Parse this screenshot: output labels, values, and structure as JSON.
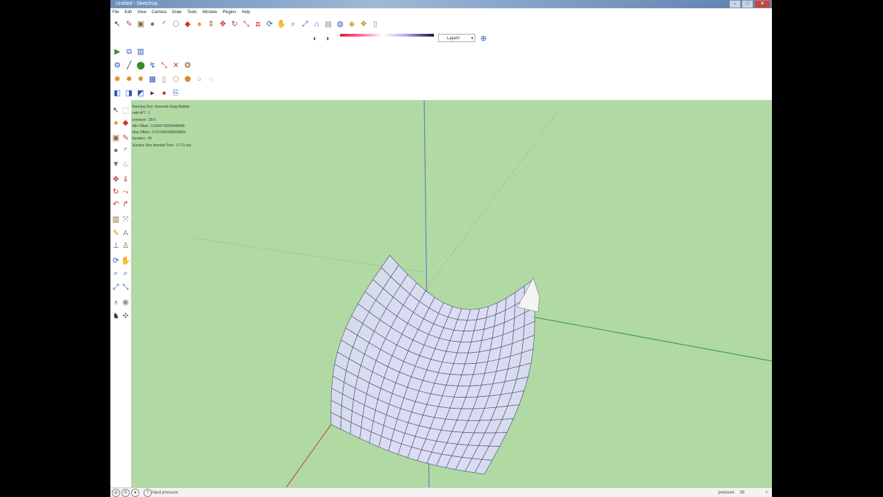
{
  "window": {
    "title": "Untitled - SketchUp"
  },
  "menu": [
    "File",
    "Edit",
    "View",
    "Camera",
    "Draw",
    "Tools",
    "Window",
    "Plugins",
    "Help"
  ],
  "layer": {
    "name": "Layer0"
  },
  "overlay": {
    "lines": [
      "Running Tool: Generate Soap Bubble",
      "ratio A/T : 1",
      "pressure : 39.0",
      "Min Offset : 0.0265715035649089",
      "Max Offset : 0.0174352686595864",
      "Iteration : 43",
      "Surface Size Needed Time : 0.772 sec."
    ]
  },
  "status": {
    "hint": "Input pressure",
    "value_label": "pressure",
    "value": "39",
    "close": "×"
  },
  "icons": {
    "row1": [
      "select-icon",
      "pencil-icon",
      "rectangle-icon",
      "circle-icon",
      "arc-icon",
      "polygon-icon",
      "eraser-icon",
      "paint-bucket-icon",
      "push-pull-icon",
      "move-icon",
      "rotate-icon",
      "scale-icon",
      "offset-icon",
      "orbit-icon",
      "pan-icon",
      "zoom-icon",
      "zoom-extents-icon",
      "3d-warehouse-icon",
      "components-icon",
      "materials-icon",
      "styles-icon",
      "layers-icon"
    ]
  },
  "colors": {
    "viewport": "#b1d9a3",
    "surface": "#dcdcf6",
    "mesh": "#3e4466"
  }
}
